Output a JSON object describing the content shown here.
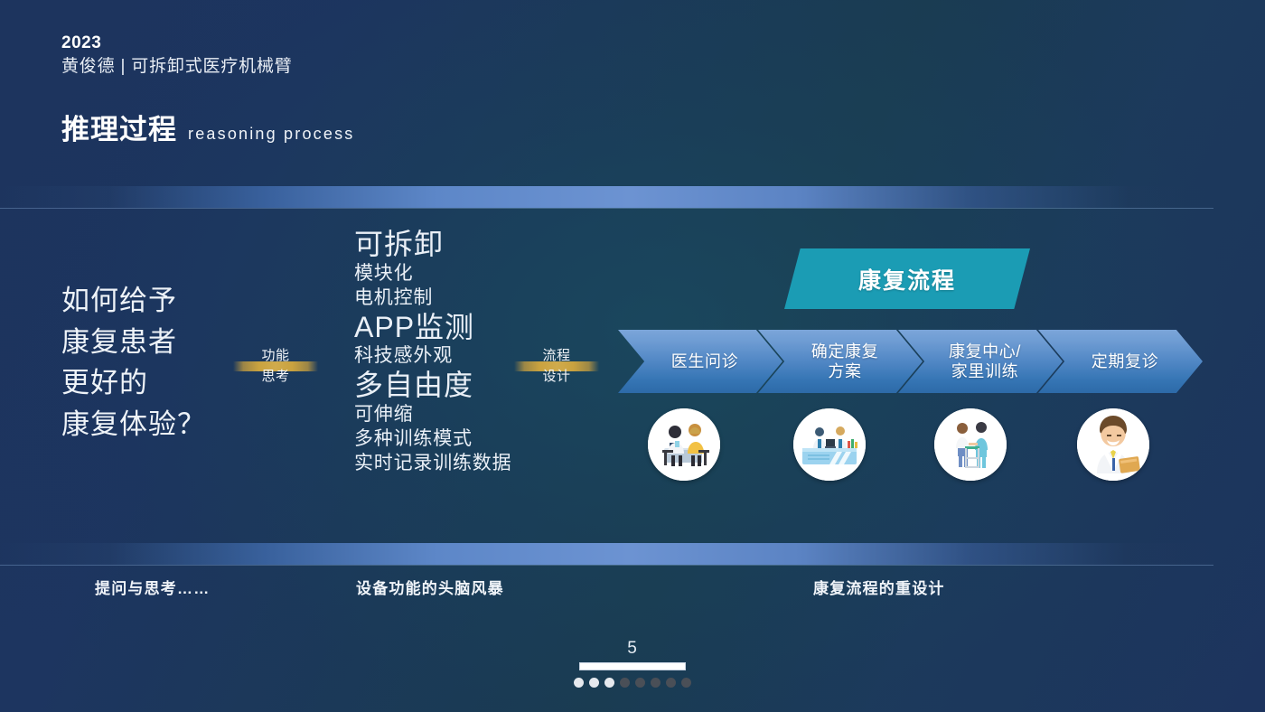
{
  "header": {
    "year": "2023",
    "author_line": "黄俊德 | 可拆卸式医疗机械臂",
    "title_cn": "推理过程",
    "title_en": "reasoning process"
  },
  "question": {
    "text": "如何给予\n康复患者\n更好的\n康复体验？"
  },
  "connectors": [
    {
      "line1": "功能",
      "line2": "思考"
    },
    {
      "line1": "流程",
      "line2": "设计"
    }
  ],
  "features": [
    {
      "text": "可拆卸",
      "size": "big"
    },
    {
      "text": "模块化",
      "size": "small"
    },
    {
      "text": "电机控制",
      "size": "small"
    },
    {
      "text": "APP监测",
      "size": "big"
    },
    {
      "text": "科技感外观",
      "size": "small"
    },
    {
      "text": "多自由度",
      "size": "big"
    },
    {
      "text": "可伸缩",
      "size": "small"
    },
    {
      "text": "多种训练模式",
      "size": "small"
    },
    {
      "text": "实时记录训练数据",
      "size": "small"
    }
  ],
  "flow": {
    "banner_label": "康复流程",
    "steps": [
      {
        "label": "医生问诊",
        "icon": "doctor-consultation-icon"
      },
      {
        "label": "确定康复\n方案",
        "icon": "reception-counter-icon"
      },
      {
        "label": "康复中心/\n家里训练",
        "icon": "walker-training-icon"
      },
      {
        "label": "定期复诊",
        "icon": "doctor-clipboard-icon"
      }
    ]
  },
  "captions": [
    "提问与思考……",
    "设备功能的头脑风暴",
    "康复流程的重设计"
  ],
  "footer": {
    "page_number": "5",
    "dots_total": 8,
    "dots_active": 3
  },
  "colors": {
    "background_navy": "#1d345e",
    "band_blue": "#6c93d2",
    "gold_bar": "#c9a23f",
    "teal_banner": "#1b9cb4",
    "chevron_blue": "#4f86c4"
  }
}
